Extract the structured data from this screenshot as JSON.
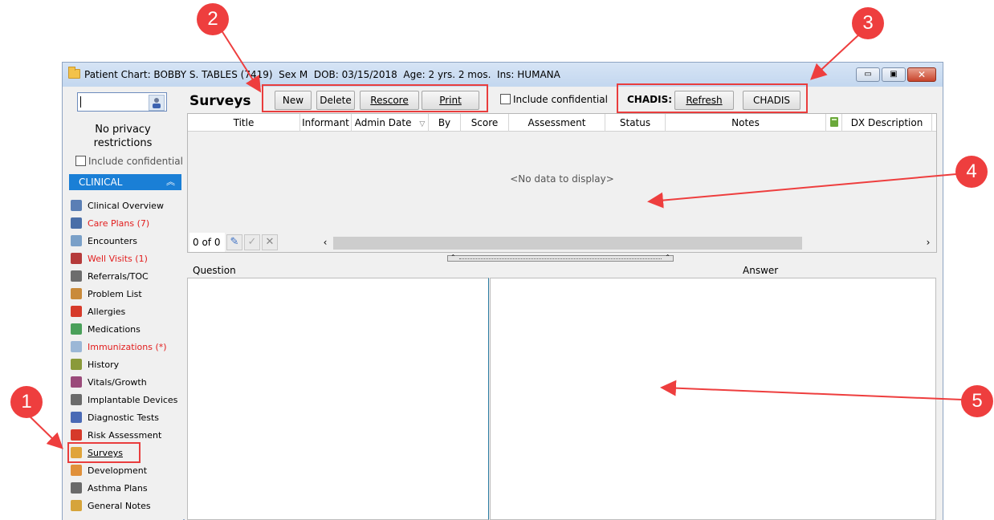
{
  "window": {
    "title": "Patient Chart: BOBBY S. TABLES (7419)  Sex M  DOB: 03/15/2018  Age: 2 yrs. 2 mos.  Ins: HUMANA",
    "minimize": "▭",
    "maximize": "▣",
    "close": "✕"
  },
  "sidebar": {
    "privacy_text": "No privacy\nrestrictions",
    "include_confidential": "Include confidential",
    "section_title": "CLINICAL",
    "section_chevron": "⌃",
    "items": [
      {
        "label": "Clinical Overview",
        "icon": "clinical-overview-icon",
        "color": "#5b7fb5",
        "alert": false
      },
      {
        "label": "Care Plans (7)",
        "icon": "care-plans-icon",
        "color": "#4a6fa8",
        "alert": true
      },
      {
        "label": "Encounters",
        "icon": "encounters-icon",
        "color": "#7aa0c8",
        "alert": false
      },
      {
        "label": "Well Visits (1)",
        "icon": "well-visits-icon",
        "color": "#b53a3a",
        "alert": true
      },
      {
        "label": "Referrals/TOC",
        "icon": "referrals-icon",
        "color": "#6d6d6d",
        "alert": false
      },
      {
        "label": "Problem List",
        "icon": "problem-list-icon",
        "color": "#c98a3a",
        "alert": false
      },
      {
        "label": "Allergies",
        "icon": "allergies-icon",
        "color": "#d63a2a",
        "alert": false
      },
      {
        "label": "Medications",
        "icon": "medications-icon",
        "color": "#4aa05a",
        "alert": false
      },
      {
        "label": "Immunizations (*)",
        "icon": "immunizations-icon",
        "color": "#9bb7d6",
        "alert": true
      },
      {
        "label": "History",
        "icon": "history-icon",
        "color": "#8a9a3a",
        "alert": false
      },
      {
        "label": "Vitals/Growth",
        "icon": "vitals-icon",
        "color": "#9a4a7a",
        "alert": false
      },
      {
        "label": "Implantable Devices",
        "icon": "implantable-devices-icon",
        "color": "#6a6a6a",
        "alert": false
      },
      {
        "label": "Diagnostic Tests",
        "icon": "diagnostic-tests-icon",
        "color": "#4a6ab5",
        "alert": false
      },
      {
        "label": "Risk Assessment",
        "icon": "risk-assessment-icon",
        "color": "#d63a2a",
        "alert": false
      },
      {
        "label": "Surveys",
        "icon": "surveys-icon",
        "color": "#e0a43a",
        "alert": false
      },
      {
        "label": "Development",
        "icon": "development-icon",
        "color": "#e0903a",
        "alert": false
      },
      {
        "label": "Asthma Plans",
        "icon": "asthma-plans-icon",
        "color": "#6a6a6a",
        "alert": false
      },
      {
        "label": "General Notes",
        "icon": "general-notes-icon",
        "color": "#d6a43a",
        "alert": false
      }
    ]
  },
  "main": {
    "title": "Surveys",
    "buttons": {
      "new": "New",
      "delete": "Delete",
      "rescore": "Rescore",
      "print": "Print"
    },
    "include_confidential": "Include confidential",
    "chadis_label": "CHADIS:",
    "chadis_buttons": {
      "refresh": "Refresh",
      "chadis": "CHADIS"
    },
    "columns": [
      "Title",
      "Informant",
      "Admin Date",
      "By",
      "Score",
      "Assessment",
      "Status",
      "Notes",
      "",
      "DX Description"
    ],
    "sort_indicator": "▽",
    "empty_text": "<No data to display>",
    "record_count": "0 of 0",
    "footer_icons": {
      "edit": "✎",
      "confirm": "✓",
      "cancel": "✕"
    },
    "scroll_left": "‹",
    "scroll_right": "›",
    "question_header": "Question",
    "answer_header": "Answer"
  },
  "callouts": [
    "1",
    "2",
    "3",
    "4",
    "5"
  ],
  "colors": {
    "accent": "#1a7fd6",
    "callout": "#ee3e3e",
    "alert_text": "#e21d1d"
  }
}
